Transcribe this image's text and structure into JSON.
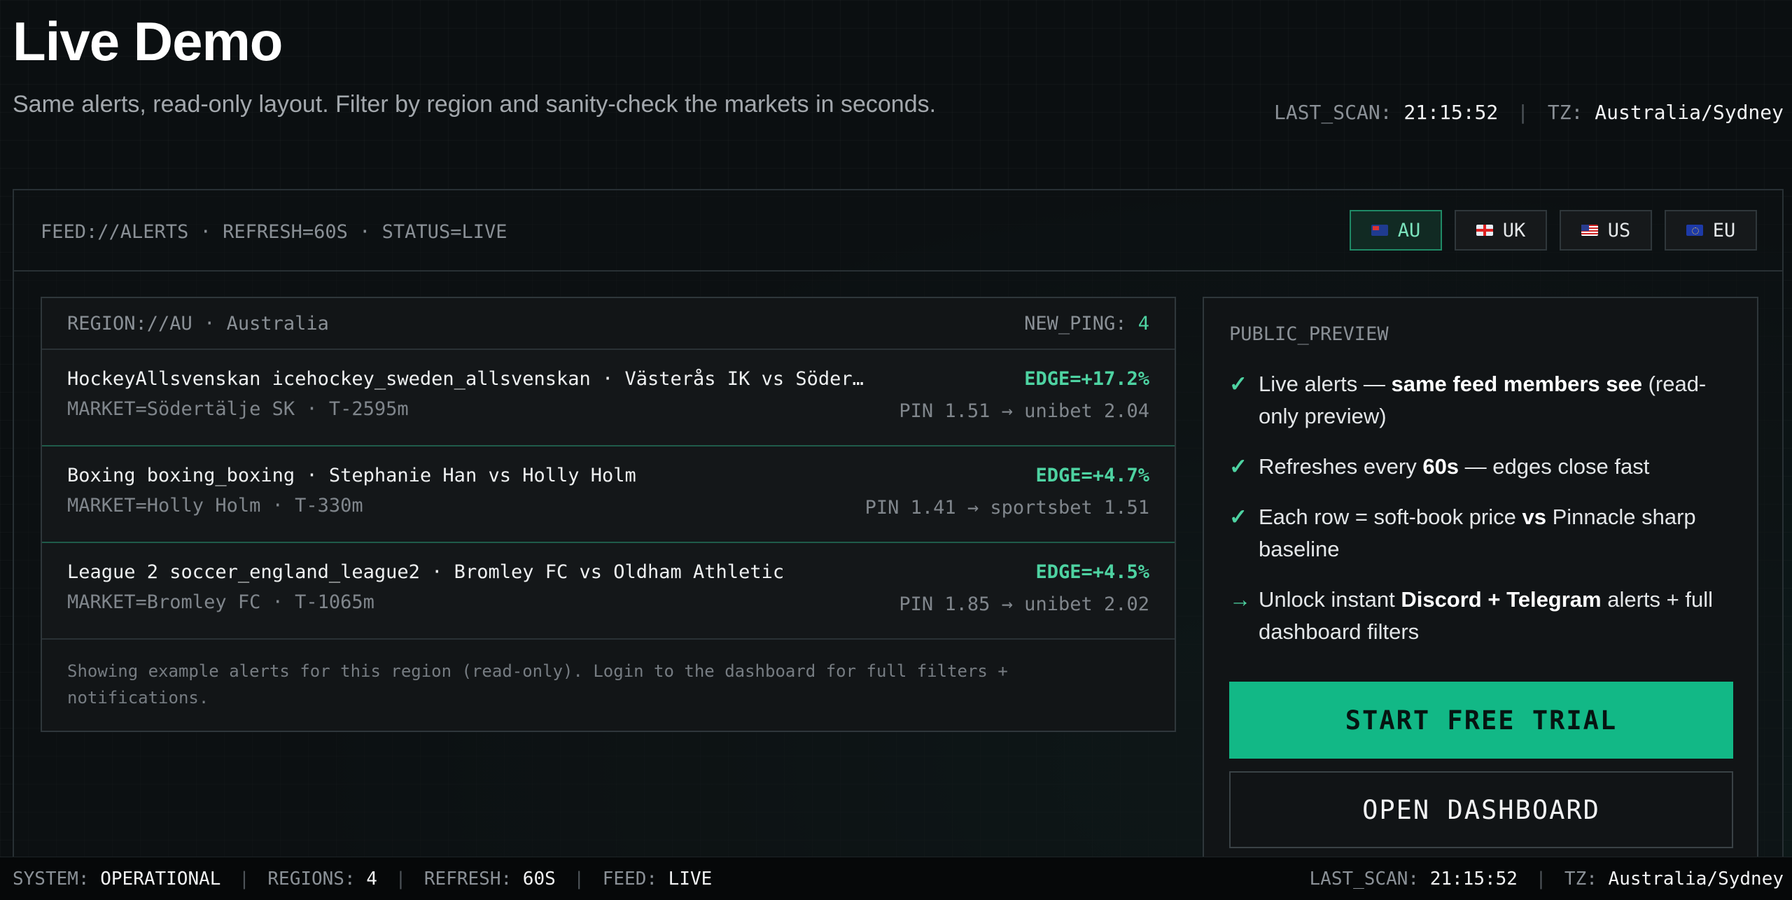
{
  "header": {
    "title": "Live Demo",
    "subtitle": "Same alerts, read-only layout. Filter by region and sanity-check the markets in seconds.",
    "last_scan_label": "LAST_SCAN:",
    "last_scan_value": "21:15:52",
    "separator": "|",
    "tz_label": "TZ:",
    "tz_value": "Australia/Sydney"
  },
  "feed_line": "FEED://ALERTS · REFRESH=60S · STATUS=LIVE",
  "region_tabs": [
    {
      "label": "AU",
      "icon": "flag-au-icon",
      "active": true
    },
    {
      "label": "UK",
      "icon": "flag-uk-icon",
      "active": false
    },
    {
      "label": "US",
      "icon": "flag-us-icon",
      "active": false
    },
    {
      "label": "EU",
      "icon": "flag-eu-icon",
      "active": false
    }
  ],
  "alerts": {
    "region_label": "REGION://AU · Australia",
    "new_ping_label": "NEW_PING:",
    "new_ping_count": "4",
    "rows": [
      {
        "title": "HockeyAllsvenskan icehockey_sweden_allsvenskan · Västerås IK vs Söder…",
        "edge": "EDGE=+17.2%",
        "market": "MARKET=Södertälje SK · T-2595m",
        "price": "PIN 1.51 → unibet 2.04"
      },
      {
        "title": "Boxing boxing_boxing · Stephanie Han vs Holly Holm",
        "edge": "EDGE=+4.7%",
        "market": "MARKET=Holly Holm · T-330m",
        "price": "PIN 1.41 → sportsbet 1.51"
      },
      {
        "title": "League 2 soccer_england_league2 · Bromley FC vs Oldham Athletic",
        "edge": "EDGE=+4.5%",
        "market": "MARKET=Bromley FC · T-1065m",
        "price": "PIN 1.85 → unibet 2.02"
      }
    ],
    "footer": "Showing example alerts for this region (read-only). Login to the dashboard for full filters + notifications."
  },
  "preview": {
    "label": "PUBLIC_PREVIEW",
    "bullets": [
      {
        "mark": "✓",
        "pre": "Live alerts — ",
        "bold": "same feed members see",
        "post": " (read-only preview)"
      },
      {
        "mark": "✓",
        "pre": "Refreshes every ",
        "bold": "60s",
        "post": " — edges close fast"
      },
      {
        "mark": "✓",
        "pre": "Each row = soft-book price ",
        "bold": "vs",
        "post": " Pinnacle sharp baseline"
      },
      {
        "mark": "→",
        "pre": "Unlock instant ",
        "bold": "Discord + Telegram",
        "post": " alerts + full dashboard filters"
      }
    ],
    "trial_button": "START FREE TRIAL",
    "dashboard_button": "OPEN DASHBOARD"
  },
  "status_bar": {
    "system_label": "SYSTEM:",
    "system_value": "OPERATIONAL",
    "regions_label": "REGIONS:",
    "regions_value": "4",
    "refresh_label": "REFRESH:",
    "refresh_value": "60S",
    "feed_label": "FEED:",
    "feed_value": "LIVE",
    "last_scan_label": "LAST_SCAN:",
    "last_scan_value": "21:15:52",
    "tz_label": "TZ:",
    "tz_value": "Australia/Sydney"
  },
  "colors": {
    "accent": "#12b886",
    "edge_text": "#4ed3a2",
    "background": "#0b0f11"
  }
}
